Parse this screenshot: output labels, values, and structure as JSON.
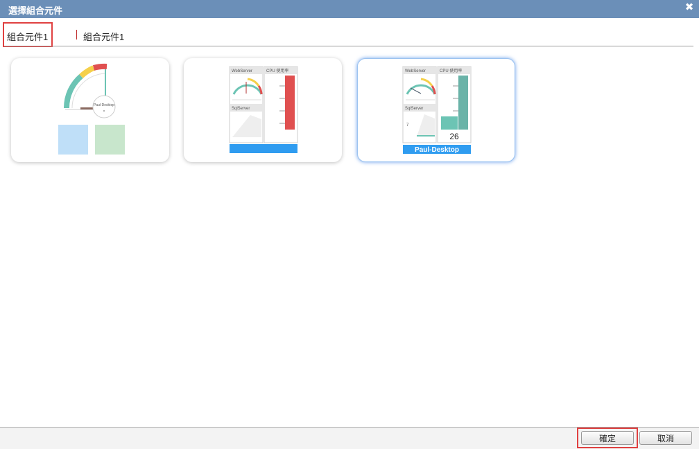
{
  "dialog": {
    "title": "選擇組合元件",
    "close_icon": "close-icon"
  },
  "tabs": [
    {
      "label": "組合元件1"
    },
    {
      "label": "組合元件1"
    }
  ],
  "cards": [
    {
      "gauge_caption": "Paul-Desktop"
    },
    {
      "panel_left_title": "WebServer",
      "panel_right_title": "CPU 使用率",
      "panel_left_sub_title": "SqlServer",
      "footer_label": ""
    },
    {
      "panel_left_title": "WebServer",
      "panel_right_title": "CPU 使用率",
      "panel_left_sub_title": "SqlServer",
      "value": "26",
      "small_value": "7",
      "footer_label": "Paul-Desktop"
    }
  ],
  "footer": {
    "confirm_label": "確定",
    "cancel_label": "取消"
  },
  "colors": {
    "titlebar": "#6b8fb8",
    "highlight": "#e04040",
    "accent_blue": "#2f9cf0",
    "teal": "#6cc4b4",
    "red": "#e05050",
    "yellow": "#f5d04a"
  }
}
